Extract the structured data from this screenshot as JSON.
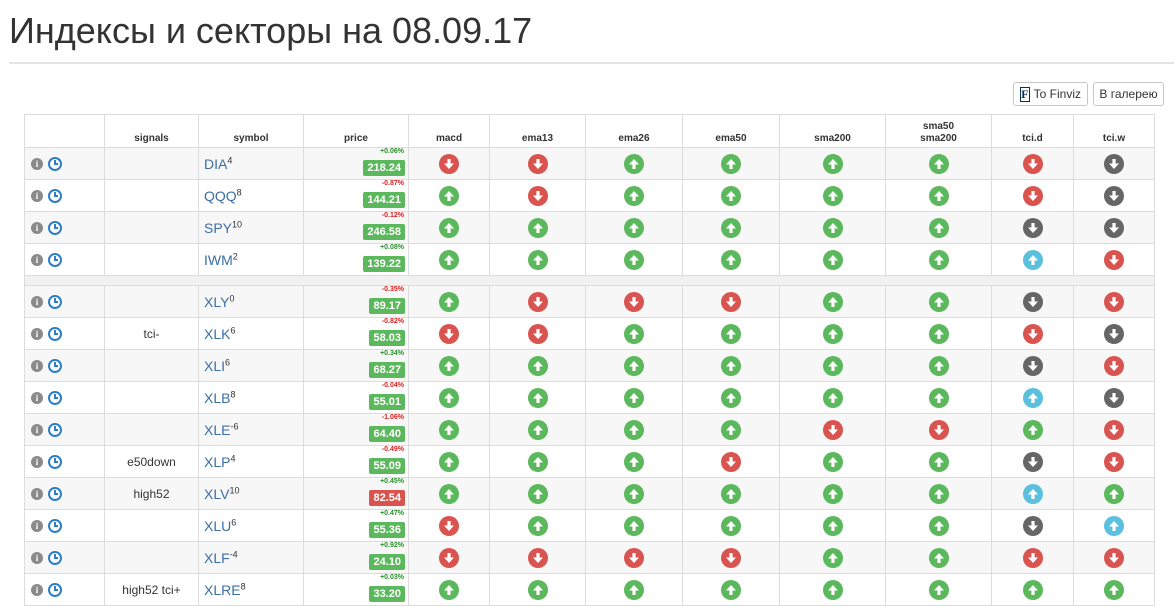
{
  "title": "Индексы и секторы на 08.09.17",
  "buttons": {
    "finviz_icon": "F",
    "finviz": "To Finviz",
    "gallery": "В галерею"
  },
  "columns": {
    "signals": "signals",
    "symbol": "symbol",
    "price": "price",
    "macd": "macd",
    "ema13": "ema13",
    "ema26": "ema26",
    "ema50": "ema50",
    "sma200": "sma200",
    "sma50_sma200_top": "sma50",
    "sma50_sma200_bottom": "sma200",
    "tci_d": "tci.d",
    "tci_w": "tci.w"
  },
  "colors": {
    "up": "#5cb85c",
    "down": "#d9534f",
    "neutral": "#666666",
    "info": "#5bc0de",
    "change_pos": "#2a8f2a",
    "change_neg": "#d62020",
    "price_green": "#5cb85c",
    "price_red": "#d9534f"
  },
  "icons": {
    "info": "i",
    "clock": "clock-icon"
  },
  "groups": [
    [
      {
        "signal": "",
        "symbol": "DIA",
        "sup": "4",
        "change": "+0.06%",
        "price": "218.24",
        "price_color": "green",
        "macd": "down",
        "ema13": "down",
        "ema26": "up",
        "ema50": "up",
        "sma200": "up",
        "sma50_200": "up",
        "tci_d": "down",
        "tci_w": "neutral"
      },
      {
        "signal": "",
        "symbol": "QQQ",
        "sup": "8",
        "change": "-0.87%",
        "price": "144.21",
        "price_color": "green",
        "macd": "up",
        "ema13": "down",
        "ema26": "up",
        "ema50": "up",
        "sma200": "up",
        "sma50_200": "up",
        "tci_d": "down",
        "tci_w": "neutral"
      },
      {
        "signal": "",
        "symbol": "SPY",
        "sup": "10",
        "change": "-0.12%",
        "price": "246.58",
        "price_color": "green",
        "macd": "up",
        "ema13": "up",
        "ema26": "up",
        "ema50": "up",
        "sma200": "up",
        "sma50_200": "up",
        "tci_d": "neutral",
        "tci_w": "neutral"
      },
      {
        "signal": "",
        "symbol": "IWM",
        "sup": "2",
        "change": "+0.08%",
        "price": "139.22",
        "price_color": "green",
        "macd": "up",
        "ema13": "up",
        "ema26": "up",
        "ema50": "up",
        "sma200": "up",
        "sma50_200": "up",
        "tci_d": "info",
        "tci_w": "down"
      }
    ],
    [
      {
        "signal": "",
        "symbol": "XLY",
        "sup": "0",
        "change": "-0.35%",
        "price": "89.17",
        "price_color": "green",
        "macd": "up",
        "ema13": "down",
        "ema26": "down",
        "ema50": "down",
        "sma200": "up",
        "sma50_200": "up",
        "tci_d": "neutral",
        "tci_w": "down"
      },
      {
        "signal": "tci-",
        "symbol": "XLK",
        "sup": "6",
        "change": "-0.82%",
        "price": "58.03",
        "price_color": "green",
        "macd": "down",
        "ema13": "down",
        "ema26": "up",
        "ema50": "up",
        "sma200": "up",
        "sma50_200": "up",
        "tci_d": "down",
        "tci_w": "neutral"
      },
      {
        "signal": "",
        "symbol": "XLI",
        "sup": "6",
        "change": "+0.34%",
        "price": "68.27",
        "price_color": "green",
        "macd": "up",
        "ema13": "up",
        "ema26": "up",
        "ema50": "up",
        "sma200": "up",
        "sma50_200": "up",
        "tci_d": "neutral",
        "tci_w": "down"
      },
      {
        "signal": "",
        "symbol": "XLB",
        "sup": "8",
        "change": "-0.04%",
        "price": "55.01",
        "price_color": "green",
        "macd": "up",
        "ema13": "up",
        "ema26": "up",
        "ema50": "up",
        "sma200": "up",
        "sma50_200": "up",
        "tci_d": "info",
        "tci_w": "neutral"
      },
      {
        "signal": "",
        "symbol": "XLE",
        "sup": "-6",
        "change": "-1.06%",
        "price": "64.40",
        "price_color": "green",
        "macd": "up",
        "ema13": "up",
        "ema26": "up",
        "ema50": "up",
        "sma200": "down",
        "sma50_200": "down",
        "tci_d": "up",
        "tci_w": "down"
      },
      {
        "signal": "e50down",
        "symbol": "XLP",
        "sup": "4",
        "change": "-0.49%",
        "price": "55.09",
        "price_color": "green",
        "macd": "up",
        "ema13": "up",
        "ema26": "up",
        "ema50": "down",
        "sma200": "up",
        "sma50_200": "up",
        "tci_d": "neutral",
        "tci_w": "down"
      },
      {
        "signal": "high52",
        "symbol": "XLV",
        "sup": "10",
        "change": "+0.45%",
        "price": "82.54",
        "price_color": "red",
        "macd": "up",
        "ema13": "up",
        "ema26": "up",
        "ema50": "up",
        "sma200": "up",
        "sma50_200": "up",
        "tci_d": "info",
        "tci_w": "up"
      },
      {
        "signal": "",
        "symbol": "XLU",
        "sup": "6",
        "change": "+0.47%",
        "price": "55.36",
        "price_color": "green",
        "macd": "down",
        "ema13": "up",
        "ema26": "up",
        "ema50": "up",
        "sma200": "up",
        "sma50_200": "up",
        "tci_d": "neutral",
        "tci_w": "info"
      },
      {
        "signal": "",
        "symbol": "XLF",
        "sup": "-4",
        "change": "+0.92%",
        "price": "24.10",
        "price_color": "green",
        "macd": "down",
        "ema13": "down",
        "ema26": "down",
        "ema50": "down",
        "sma200": "up",
        "sma50_200": "up",
        "tci_d": "down",
        "tci_w": "down"
      },
      {
        "signal": "high52 tci+",
        "symbol": "XLRE",
        "sup": "8",
        "change": "+0.03%",
        "price": "33.20",
        "price_color": "green",
        "macd": "up",
        "ema13": "up",
        "ema26": "up",
        "ema50": "up",
        "sma200": "up",
        "sma50_200": "up",
        "tci_d": "up",
        "tci_w": "up"
      }
    ]
  ]
}
